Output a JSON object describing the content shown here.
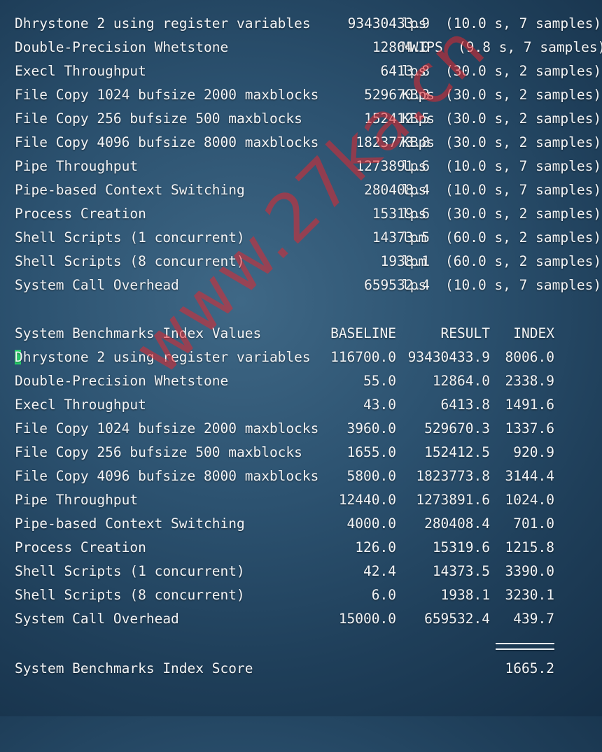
{
  "results": [
    {
      "name": "Dhrystone 2 using register variables",
      "value": "93430433.9",
      "unit": "lps",
      "samples": "(10.0 s, 7 samples)"
    },
    {
      "name": "Double-Precision Whetstone",
      "value": "12864.0",
      "unit": "MWIPS",
      "samples": "(9.8 s, 7 samples)"
    },
    {
      "name": "Execl Throughput",
      "value": "6413.8",
      "unit": "lps",
      "samples": "(30.0 s, 2 samples)"
    },
    {
      "name": "File Copy 1024 bufsize 2000 maxblocks",
      "value": "529670.3",
      "unit": "KBps",
      "samples": "(30.0 s, 2 samples)"
    },
    {
      "name": "File Copy 256 bufsize 500 maxblocks",
      "value": "152412.5",
      "unit": "KBps",
      "samples": "(30.0 s, 2 samples)"
    },
    {
      "name": "File Copy 4096 bufsize 8000 maxblocks",
      "value": "1823773.8",
      "unit": "KBps",
      "samples": "(30.0 s, 2 samples)"
    },
    {
      "name": "Pipe Throughput",
      "value": "1273891.6",
      "unit": "lps",
      "samples": "(10.0 s, 7 samples)"
    },
    {
      "name": "Pipe-based Context Switching",
      "value": "280408.4",
      "unit": "lps",
      "samples": "(10.0 s, 7 samples)"
    },
    {
      "name": "Process Creation",
      "value": "15319.6",
      "unit": "lps",
      "samples": "(30.0 s, 2 samples)"
    },
    {
      "name": "Shell Scripts (1 concurrent)",
      "value": "14373.5",
      "unit": "lpm",
      "samples": "(60.0 s, 2 samples)"
    },
    {
      "name": "Shell Scripts (8 concurrent)",
      "value": "1938.1",
      "unit": "lpm",
      "samples": "(60.0 s, 2 samples)"
    },
    {
      "name": "System Call Overhead",
      "value": "659532.4",
      "unit": "lps",
      "samples": "(10.0 s, 7 samples)"
    }
  ],
  "index_header": {
    "title": "System Benchmarks Index Values",
    "baseline": "BASELINE",
    "result": "RESULT",
    "index": "INDEX"
  },
  "index_rows": [
    {
      "name": "Dhrystone 2 using register variables",
      "baseline": "116700.0",
      "result": "93430433.9",
      "index": "8006.0"
    },
    {
      "name": "Double-Precision Whetstone",
      "baseline": "55.0",
      "result": "12864.0",
      "index": "2338.9"
    },
    {
      "name": "Execl Throughput",
      "baseline": "43.0",
      "result": "6413.8",
      "index": "1491.6"
    },
    {
      "name": "File Copy 1024 bufsize 2000 maxblocks",
      "baseline": "3960.0",
      "result": "529670.3",
      "index": "1337.6"
    },
    {
      "name": "File Copy 256 bufsize 500 maxblocks",
      "baseline": "1655.0",
      "result": "152412.5",
      "index": "920.9"
    },
    {
      "name": "File Copy 4096 bufsize 8000 maxblocks",
      "baseline": "5800.0",
      "result": "1823773.8",
      "index": "3144.4"
    },
    {
      "name": "Pipe Throughput",
      "baseline": "12440.0",
      "result": "1273891.6",
      "index": "1024.0"
    },
    {
      "name": "Pipe-based Context Switching",
      "baseline": "4000.0",
      "result": "280408.4",
      "index": "701.0"
    },
    {
      "name": "Process Creation",
      "baseline": "126.0",
      "result": "15319.6",
      "index": "1215.8"
    },
    {
      "name": "Shell Scripts (1 concurrent)",
      "baseline": "42.4",
      "result": "14373.5",
      "index": "3390.0"
    },
    {
      "name": "Shell Scripts (8 concurrent)",
      "baseline": "6.0",
      "result": "1938.1",
      "index": "3230.1"
    },
    {
      "name": "System Call Overhead",
      "baseline": "15000.0",
      "result": "659532.4",
      "index": "439.7"
    }
  ],
  "score": {
    "label": "System Benchmarks Index Score",
    "value": "1665.2"
  },
  "watermark": "www.27ka.cn",
  "colors": {
    "text": "#f2f4f6",
    "cursor": "#27d16a",
    "watermark": "#e22830"
  }
}
